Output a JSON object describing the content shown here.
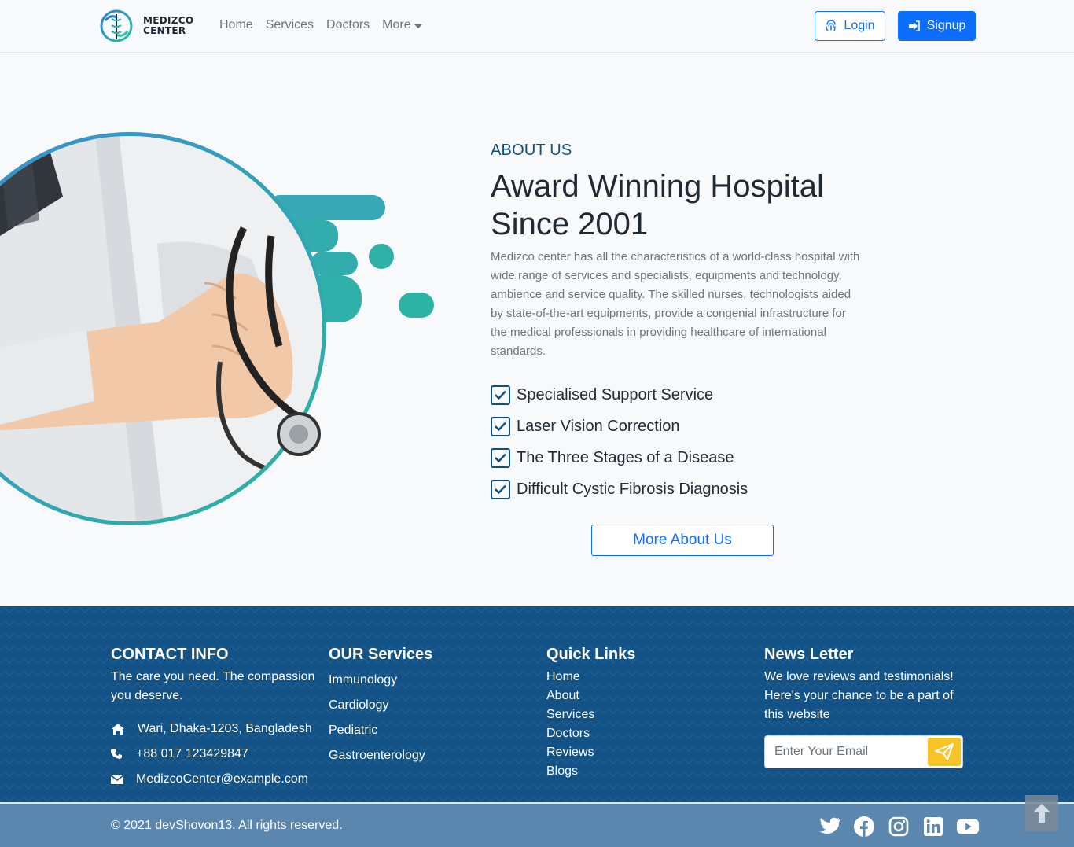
{
  "brand": {
    "line1": "MEDIZCO",
    "line2": "CENTER",
    "icon": "caduceus-logo"
  },
  "nav": {
    "links": [
      "Home",
      "Services",
      "Doctors"
    ],
    "more_label": "More",
    "login_label": "Login",
    "signup_label": "Signup"
  },
  "about": {
    "subtitle": "ABOUT US",
    "title": "Award Winning Hospital Since 2001",
    "description": "Medizco center has all the characteristics of a world-class hospital with wide range of services and specialists, equipments and technology, ambience and service quality. The skilled nurses, technologists aided by state-of-the-art equipments, provide a congenial infrastructure for the medical professionals in providing healthcare of international standards.",
    "checklist": [
      "Specialised Support Service",
      "Laser Vision Correction",
      "The Three Stages of a Disease",
      "Difficult Cystic Fibrosis Diagnosis"
    ],
    "button_label": "More About Us"
  },
  "footer": {
    "contact": {
      "heading": "CONTACT INFO",
      "tagline": "The care you need. The compassion you deserve.",
      "address": "Wari, Dhaka-1203, Bangladesh",
      "phone": "+88 017 123429847",
      "email": "MedizcoCenter@example.com"
    },
    "services": {
      "heading": "OUR Services",
      "items": [
        "Immunology",
        "Cardiology",
        "Pediatric",
        "Gastroenterology"
      ]
    },
    "quick_links": {
      "heading": "Quick Links",
      "items": [
        "Home",
        "About",
        "Services",
        "Doctors",
        "Reviews",
        "Blogs"
      ]
    },
    "newsletter": {
      "heading": "News Letter",
      "text": "We love reviews and testimonials! Here's your chance to be a part of this website",
      "placeholder": "Enter Your Email"
    },
    "copyright": "© 2021 devShovon13. All rights reserved.",
    "socials": [
      "twitter-icon",
      "facebook-icon",
      "instagram-icon",
      "linkedin-icon",
      "youtube-icon"
    ]
  },
  "colors": {
    "primary": "#0d6efd",
    "navy": "#0d4f82",
    "footer_bg": "#125286",
    "bottom_bar": "#5b86ad",
    "accent_yellow": "#f7c325",
    "teal": "#2fb0a4"
  }
}
